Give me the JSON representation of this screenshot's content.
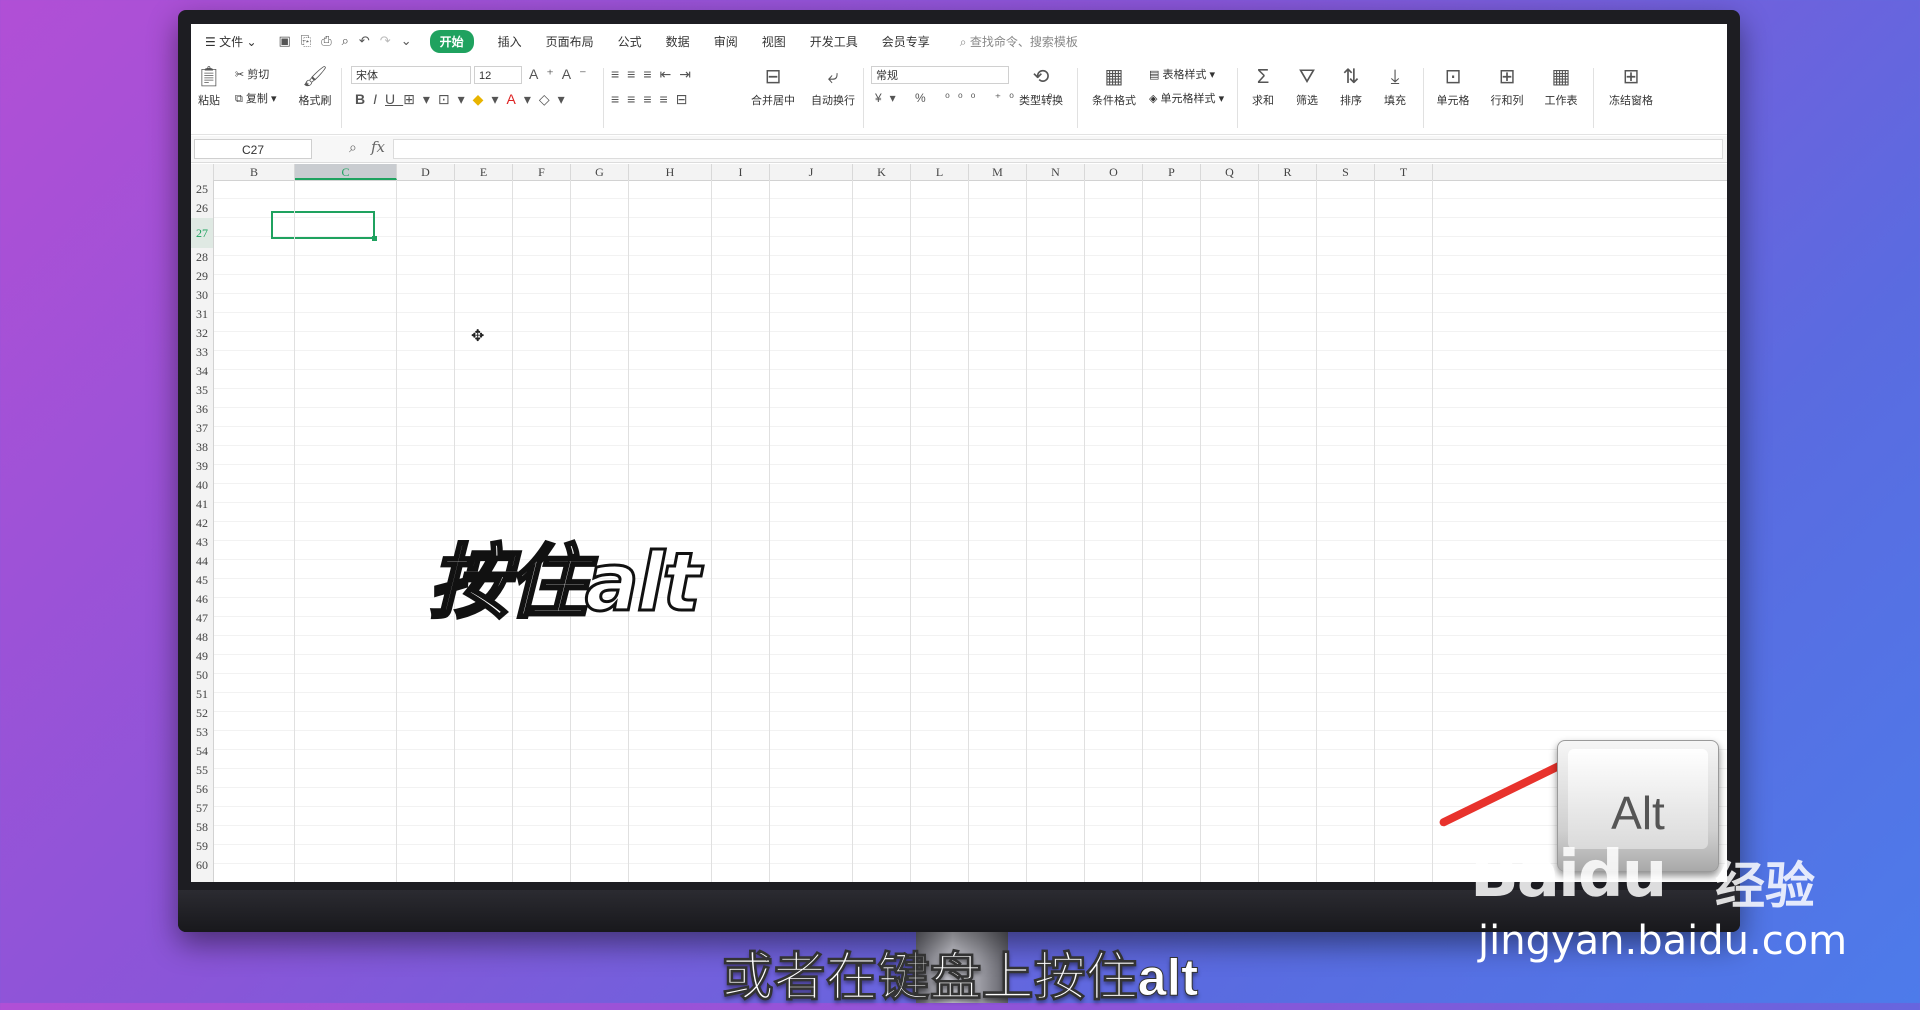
{
  "menubar": {
    "file": "文件",
    "tabs": [
      "开始",
      "插入",
      "页面布局",
      "公式",
      "数据",
      "审阅",
      "视图",
      "开发工具",
      "会员专享"
    ],
    "active_tab": "开始",
    "search_placeholder": "查找命令、搜索模板"
  },
  "ribbon": {
    "paste": "粘贴",
    "cut": "剪切",
    "copy": "复制",
    "format_painter": "格式刷",
    "font_name": "宋体",
    "font_size": "12",
    "merge_center": "合并居中",
    "wrap_text": "自动换行",
    "number_format": "常规",
    "type_convert": "类型转换",
    "conditional_format": "条件格式",
    "table_style": "表格样式",
    "cell_style": "单元格样式",
    "sum": "求和",
    "filter": "筛选",
    "sort": "排序",
    "fill": "填充",
    "cell": "单元格",
    "row_col": "行和列",
    "worksheet": "工作表",
    "freeze": "冻结窗格"
  },
  "formula_bar": {
    "name_box": "C27",
    "fx": "fx",
    "content": ""
  },
  "grid": {
    "columns": [
      "B",
      "C",
      "D",
      "E",
      "F",
      "G",
      "H",
      "I",
      "J",
      "K",
      "L",
      "M",
      "N",
      "O",
      "P",
      "Q",
      "R",
      "S",
      "T"
    ],
    "selected_column": "C",
    "rows": [
      "25",
      "26",
      "27",
      "28",
      "29",
      "30",
      "31",
      "32",
      "33",
      "34",
      "35",
      "36",
      "37",
      "38",
      "39",
      "40",
      "41",
      "42",
      "43",
      "44",
      "45",
      "46",
      "47",
      "48",
      "49",
      "50",
      "51",
      "52",
      "53",
      "54",
      "55",
      "56",
      "57",
      "58",
      "59",
      "60"
    ],
    "selected_row": "27",
    "selected_cell": "C27"
  },
  "overlay_text": "按住alt",
  "key_label": "Alt",
  "watermark": {
    "brand": "Baidu",
    "brand_cn": "经验",
    "url": "jingyan.baidu.com"
  },
  "subtitle": "或者在键盘上按住alt",
  "colors": {
    "accent": "#1fa25f",
    "arrow": "#e8322c"
  }
}
